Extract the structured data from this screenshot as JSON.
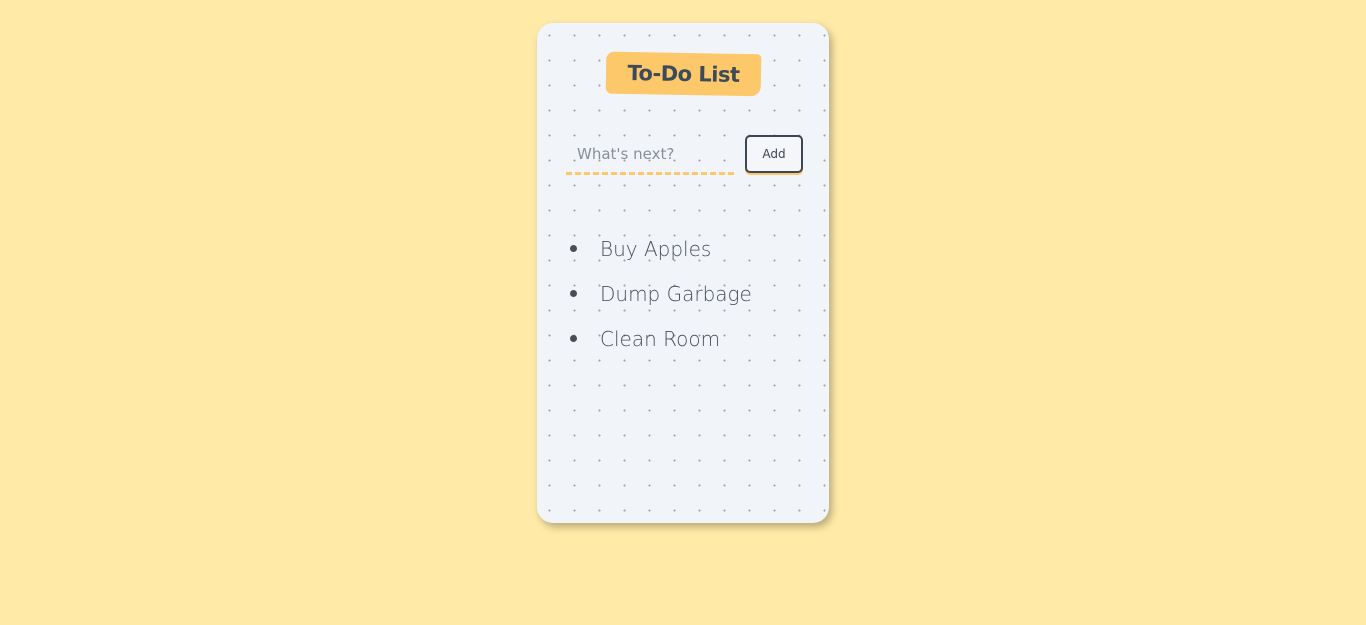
{
  "app": {
    "title": "To-Do List"
  },
  "input": {
    "placeholder": "What's next?",
    "value": ""
  },
  "add_button": {
    "label": "Add"
  },
  "todos": [
    {
      "label": "Buy Apples"
    },
    {
      "label": "Dump Garbage"
    },
    {
      "label": "Clean Room"
    }
  ],
  "colors": {
    "background": "#ffeaa7",
    "card": "#f1f4f9",
    "accent": "#fdc86a",
    "text": "#3d4a57"
  }
}
